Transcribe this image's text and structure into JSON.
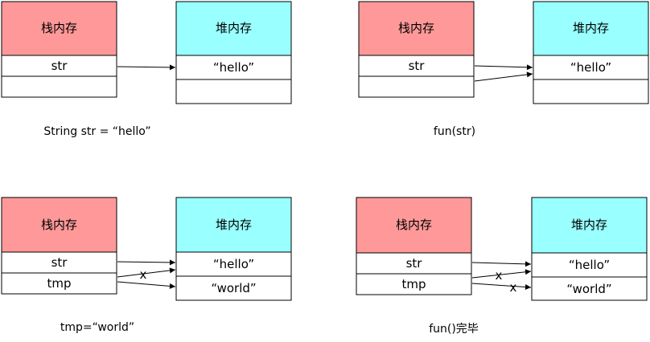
{
  "colors": {
    "stack": "#ff9999",
    "heap": "#99ffff",
    "border": "#000000",
    "arrow": "#000000"
  },
  "stack_label": "栈内存",
  "heap_label": "堆内存",
  "panels": [
    {
      "caption": "String str = “hello”",
      "stack_rows": [
        "str",
        ""
      ],
      "heap_rows": [
        "“hello”",
        ""
      ],
      "cross_marks": []
    },
    {
      "caption": "fun(str)",
      "stack_rows": [
        "str",
        ""
      ],
      "heap_rows": [
        "“hello”",
        ""
      ],
      "cross_marks": []
    },
    {
      "caption": "tmp=“world”",
      "stack_rows": [
        "str",
        "tmp"
      ],
      "heap_rows": [
        "“hello”",
        "“world”"
      ],
      "cross_marks": [
        "x"
      ]
    },
    {
      "caption": "fun()完毕",
      "stack_rows": [
        "str",
        "tmp"
      ],
      "heap_rows": [
        "“hello”",
        "“world”"
      ],
      "cross_marks": [
        "x",
        "x"
      ]
    }
  ]
}
